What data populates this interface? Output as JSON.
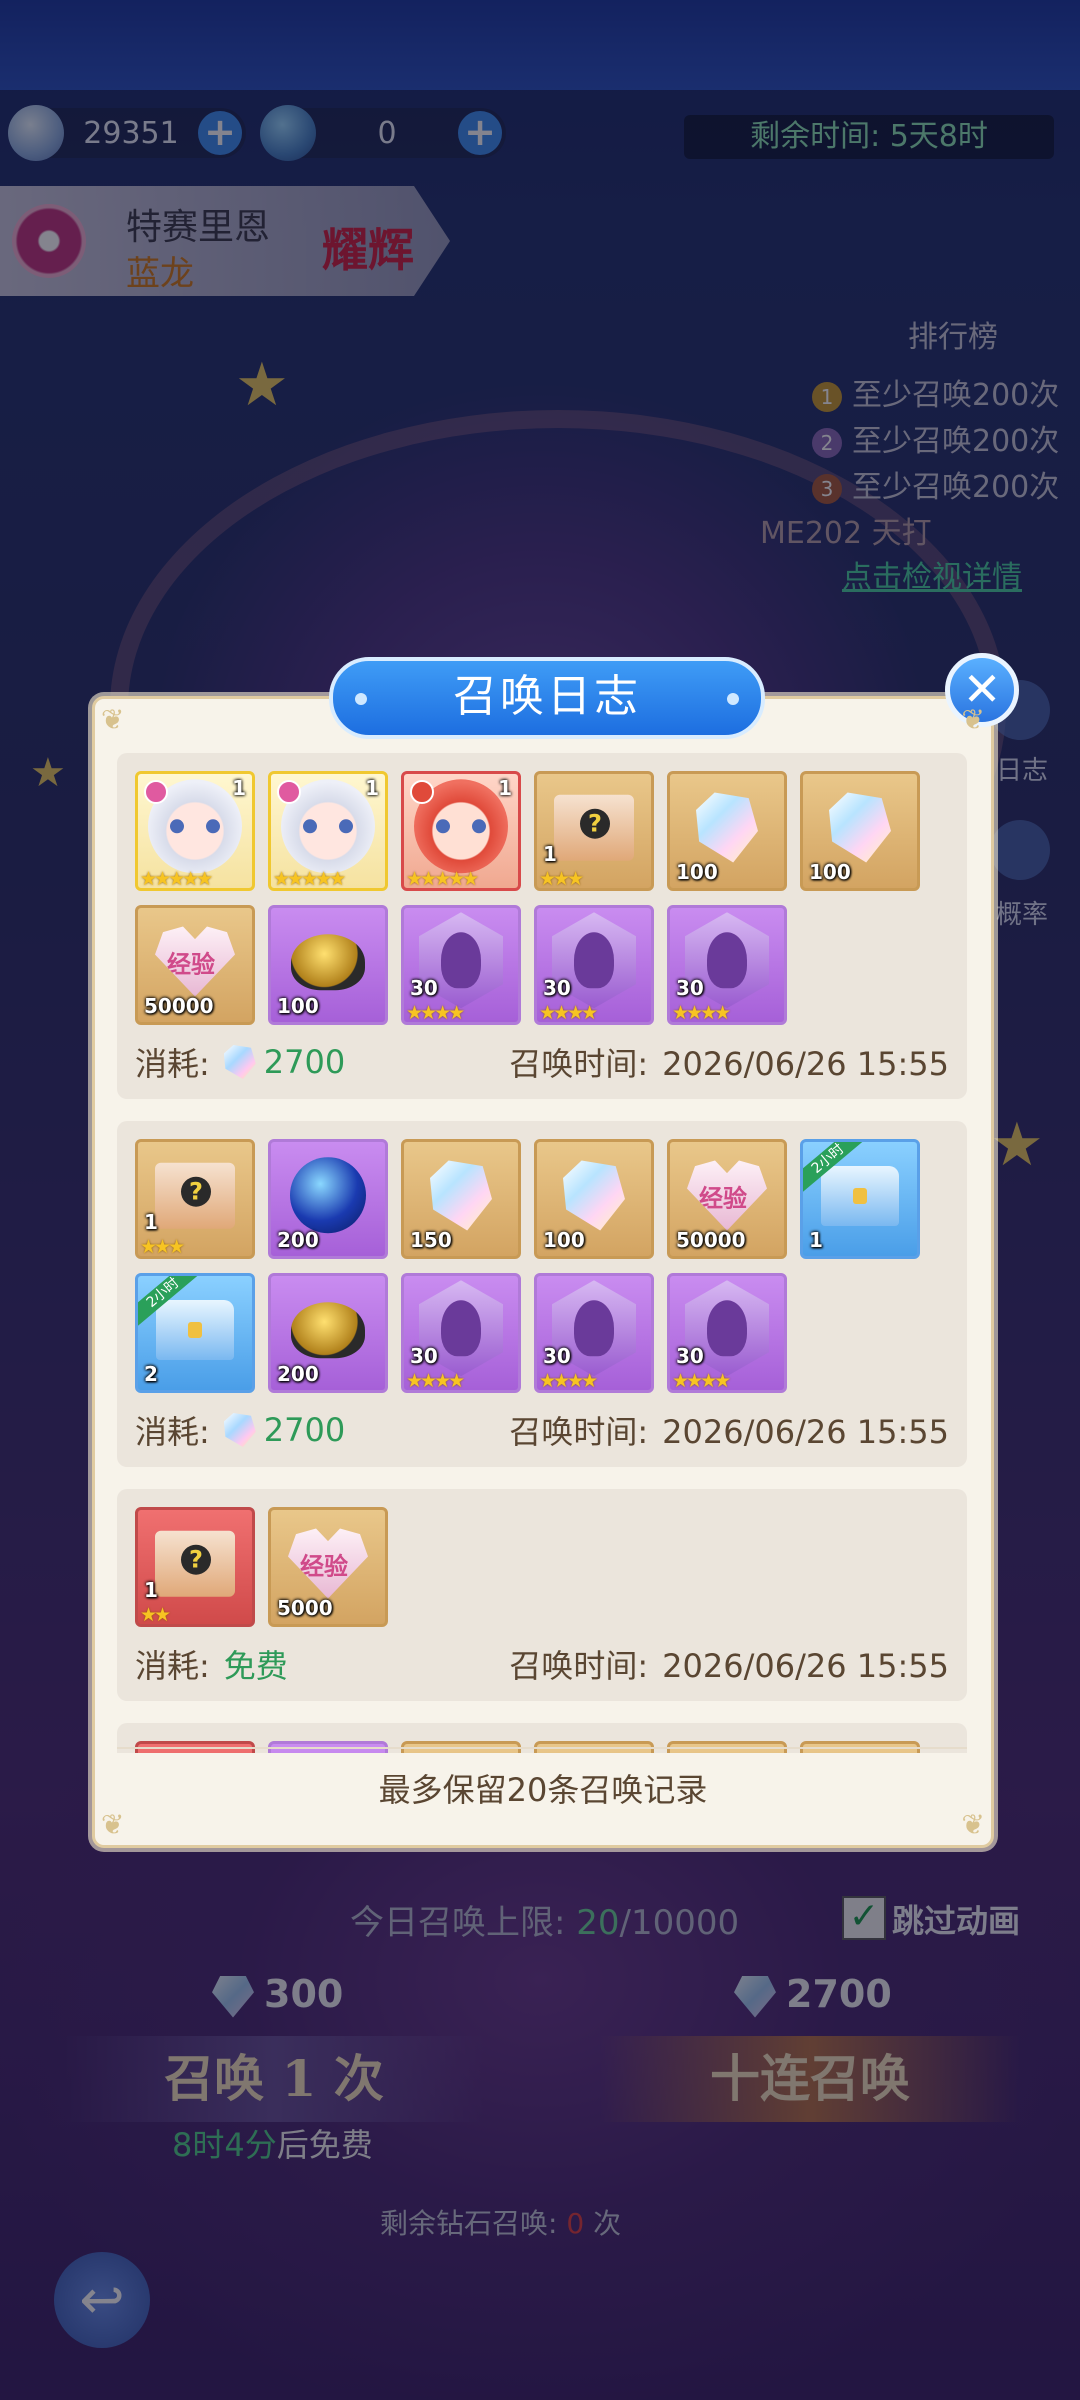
{
  "currency": {
    "gems": "29351",
    "tickets": "0",
    "plus": "+"
  },
  "event": {
    "remaining_time": "剩余时间: 5天8时"
  },
  "hero": {
    "name": "特赛里恩",
    "subtitle": "蓝龙",
    "badge": "耀辉"
  },
  "ranking": {
    "title": "排行榜",
    "rows": [
      {
        "num": "1",
        "text": "至少召唤200次"
      },
      {
        "num": "2",
        "text": "至少召唤200次"
      },
      {
        "num": "3",
        "text": "至少召唤200次"
      }
    ],
    "extra": "ME202  天打",
    "link": "点击检视详情"
  },
  "side_buttons": {
    "log": "日志",
    "rate": "概率"
  },
  "modal": {
    "title": "召唤日志",
    "close": "✕",
    "footer": "最多保留20条召唤记录",
    "records": [
      {
        "cost_label": "消耗:",
        "cost_value": "2700",
        "time_label": "召唤时间:",
        "time_value": "2026/06/26 15:55",
        "items": [
          {
            "kind": "face",
            "style": "hero-gold",
            "count": "1",
            "stars": "★★★★★",
            "el": "light"
          },
          {
            "kind": "face",
            "style": "hero-gold",
            "count": "1",
            "stars": "★★★★★",
            "el": "light"
          },
          {
            "kind": "face red",
            "style": "hero-red",
            "count": "1",
            "stars": "★★★★★",
            "el": "fire"
          },
          {
            "kind": "box",
            "style": "",
            "count": "1",
            "stars": "★★★"
          },
          {
            "kind": "crystal",
            "style": "",
            "count": "100",
            "stars": ""
          },
          {
            "kind": "crystal",
            "style": "",
            "count": "100",
            "stars": ""
          },
          {
            "kind": "heart",
            "style": "",
            "count": "50000",
            "stars": ""
          },
          {
            "kind": "gold",
            "style": "purple",
            "count": "100",
            "stars": ""
          },
          {
            "kind": "shadow",
            "style": "purple",
            "count": "30",
            "stars": "★★★★"
          },
          {
            "kind": "shadow",
            "style": "purple",
            "count": "30",
            "stars": "★★★★"
          },
          {
            "kind": "shadow",
            "style": "purple",
            "count": "30",
            "stars": "★★★★"
          }
        ]
      },
      {
        "cost_label": "消耗:",
        "cost_value": "2700",
        "time_label": "召唤时间:",
        "time_value": "2026/06/26 15:55",
        "items": [
          {
            "kind": "box",
            "style": "",
            "count": "1",
            "stars": "★★★"
          },
          {
            "kind": "orb",
            "style": "purple",
            "count": "200",
            "stars": ""
          },
          {
            "kind": "crystal",
            "style": "",
            "count": "150",
            "stars": ""
          },
          {
            "kind": "crystal",
            "style": "",
            "count": "100",
            "stars": ""
          },
          {
            "kind": "heart",
            "style": "",
            "count": "50000",
            "stars": ""
          },
          {
            "kind": "chest",
            "style": "blue",
            "count": "1",
            "stars": "",
            "ribbon": "2小时"
          },
          {
            "kind": "chest",
            "style": "blue",
            "count": "2",
            "stars": "",
            "ribbon": "2小时"
          },
          {
            "kind": "gold",
            "style": "purple",
            "count": "200",
            "stars": ""
          },
          {
            "kind": "shadow",
            "style": "purple",
            "count": "30",
            "stars": "★★★★"
          },
          {
            "kind": "shadow",
            "style": "purple",
            "count": "30",
            "stars": "★★★★"
          },
          {
            "kind": "shadow",
            "style": "purple",
            "count": "30",
            "stars": "★★★★"
          }
        ]
      },
      {
        "cost_label": "消耗:",
        "cost_value": "免费",
        "time_label": "召唤时间:",
        "time_value": "2026/06/26 15:55",
        "items": [
          {
            "kind": "box",
            "style": "red",
            "count": "1",
            "stars": "★★"
          },
          {
            "kind": "heart",
            "style": "",
            "count": "5000",
            "stars": ""
          }
        ]
      },
      {
        "cost_label": "",
        "cost_value": "",
        "time_label": "",
        "time_value": "",
        "items": [
          {
            "kind": "box",
            "style": "red",
            "count": "",
            "stars": ""
          },
          {
            "kind": "orb",
            "style": "purple",
            "count": "",
            "stars": ""
          },
          {
            "kind": "crystal",
            "style": "",
            "count": "",
            "stars": ""
          },
          {
            "kind": "crystal",
            "style": "",
            "count": "",
            "stars": ""
          },
          {
            "kind": "crystal",
            "style": "",
            "count": "",
            "stars": ""
          },
          {
            "kind": "heart",
            "style": "",
            "count": "",
            "stars": ""
          }
        ]
      }
    ]
  },
  "summon": {
    "daily_limit_label": "今日召唤上限:",
    "daily_limit_used": "20",
    "daily_limit_max": "/10000",
    "skip_check": "✓",
    "skip_label": "跳过动画",
    "single_cost": "300",
    "ten_cost": "2700",
    "single_label": "召唤 1 次",
    "ten_label": "十连召唤",
    "free_time": "8时4分",
    "free_suffix": "后免费",
    "diamond_label": "剩余钻石召唤:",
    "diamond_count": "0",
    "diamond_unit": "次",
    "back_icon": "↩"
  }
}
